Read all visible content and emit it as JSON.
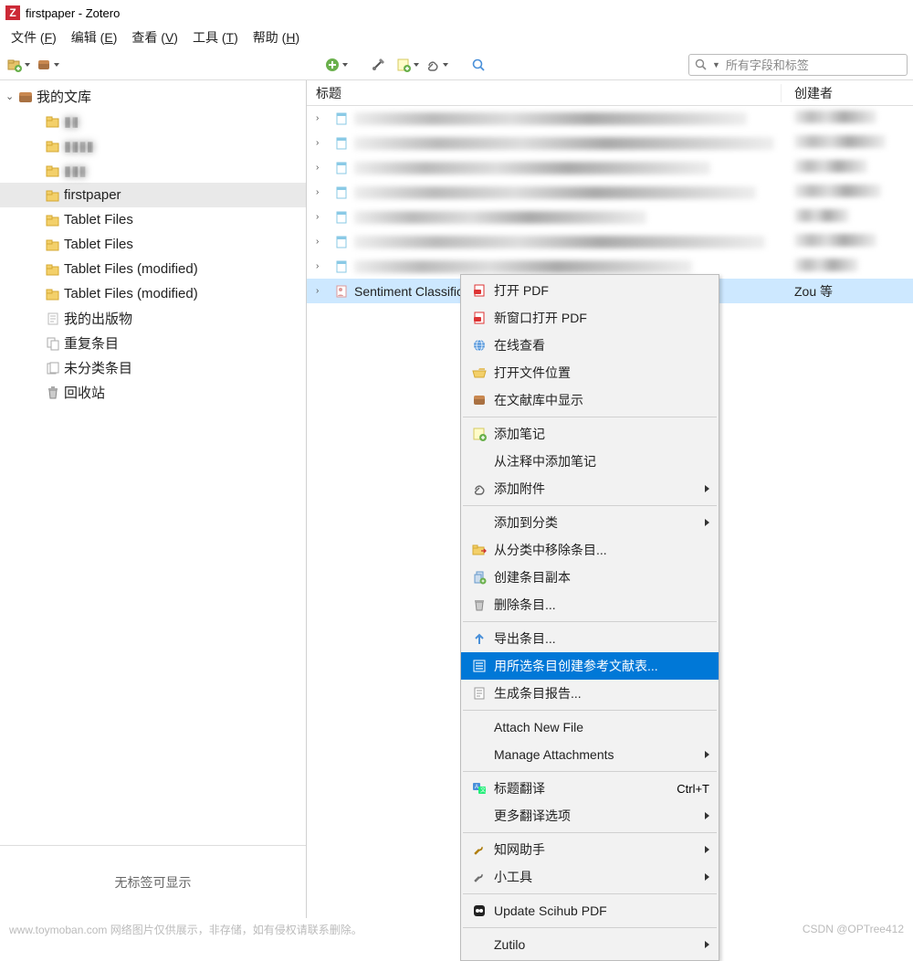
{
  "window": {
    "title": "firstpaper - Zotero"
  },
  "menubar": [
    {
      "label": "文件",
      "key": "F"
    },
    {
      "label": "编辑",
      "key": "E"
    },
    {
      "label": "查看",
      "key": "V"
    },
    {
      "label": "工具",
      "key": "T"
    },
    {
      "label": "帮助",
      "key": "H"
    }
  ],
  "search": {
    "placeholder": "所有字段和标签"
  },
  "sidebar": {
    "root": "我的文库",
    "items": [
      {
        "label": "▮▮",
        "icon": "folder",
        "blurred": true
      },
      {
        "label": "▮▮▮▮",
        "icon": "folder",
        "blurred": true
      },
      {
        "label": "▮▮▮",
        "icon": "folder",
        "blurred": true
      },
      {
        "label": "firstpaper",
        "icon": "folder",
        "selected": true
      },
      {
        "label": "Tablet Files",
        "icon": "folder"
      },
      {
        "label": "Tablet Files",
        "icon": "folder"
      },
      {
        "label": "Tablet Files (modified)",
        "icon": "folder"
      },
      {
        "label": "Tablet Files (modified)",
        "icon": "folder"
      },
      {
        "label": "我的出版物",
        "icon": "doc"
      },
      {
        "label": "重复条目",
        "icon": "dup"
      },
      {
        "label": "未分类条目",
        "icon": "unfiled"
      },
      {
        "label": "回收站",
        "icon": "trash"
      }
    ],
    "tag_empty": "无标签可显示"
  },
  "columns": {
    "title": "标题",
    "creator": "创建者"
  },
  "rows": [
    {
      "title_blur": 430,
      "creator_blur": 90
    },
    {
      "title_blur": 460,
      "creator_blur": 100
    },
    {
      "title_blur": 390,
      "creator_blur": 80
    },
    {
      "title_blur": 440,
      "creator_blur": 95
    },
    {
      "title_blur": 320,
      "creator_blur": 60
    },
    {
      "title_blur": 450,
      "creator_blur": 90
    },
    {
      "title_blur": 370,
      "creator_blur": 70
    }
  ],
  "selected_row": {
    "title": "Sentiment Classification Using Machine Learning Techni...",
    "creator": "Zou 等"
  },
  "context_menu": [
    {
      "type": "item",
      "label": "打开 PDF",
      "icon": "pdf"
    },
    {
      "type": "item",
      "label": "新窗口打开 PDF",
      "icon": "pdf"
    },
    {
      "type": "item",
      "label": "在线查看",
      "icon": "globe"
    },
    {
      "type": "item",
      "label": "打开文件位置",
      "icon": "folder-open"
    },
    {
      "type": "item",
      "label": "在文献库中显示",
      "icon": "box"
    },
    {
      "type": "sep"
    },
    {
      "type": "item",
      "label": "添加笔记",
      "icon": "note"
    },
    {
      "type": "item",
      "label": "从注释中添加笔记",
      "icon": ""
    },
    {
      "type": "item",
      "label": "添加附件",
      "icon": "clip",
      "submenu": true
    },
    {
      "type": "sep"
    },
    {
      "type": "item",
      "label": "添加到分类",
      "icon": "",
      "submenu": true
    },
    {
      "type": "item",
      "label": "从分类中移除条目...",
      "icon": "folder-out"
    },
    {
      "type": "item",
      "label": "创建条目副本",
      "icon": "dup"
    },
    {
      "type": "item",
      "label": "删除条目...",
      "icon": "trash"
    },
    {
      "type": "sep"
    },
    {
      "type": "item",
      "label": "导出条目...",
      "icon": "export"
    },
    {
      "type": "item",
      "label": "用所选条目创建参考文献表...",
      "icon": "list",
      "highlighted": true
    },
    {
      "type": "item",
      "label": "生成条目报告...",
      "icon": "report"
    },
    {
      "type": "sep"
    },
    {
      "type": "item",
      "label": "Attach New File",
      "icon": ""
    },
    {
      "type": "item",
      "label": "Manage Attachments",
      "icon": "",
      "submenu": true
    },
    {
      "type": "sep"
    },
    {
      "type": "item",
      "label": "标题翻译",
      "icon": "translate",
      "shortcut": "Ctrl+T"
    },
    {
      "type": "item",
      "label": "更多翻译选项",
      "icon": "",
      "submenu": true
    },
    {
      "type": "sep"
    },
    {
      "type": "item",
      "label": "知网助手",
      "icon": "wrench",
      "submenu": true
    },
    {
      "type": "item",
      "label": "小工具",
      "icon": "wrench2",
      "submenu": true
    },
    {
      "type": "sep"
    },
    {
      "type": "item",
      "label": "Update Scihub PDF",
      "icon": "scihub"
    },
    {
      "type": "sep"
    },
    {
      "type": "item",
      "label": "Zutilo",
      "icon": "",
      "submenu": true
    }
  ],
  "footer": {
    "left": "www.toymoban.com 网络图片仅供展示，非存储，如有侵权请联系删除。",
    "right": "CSDN @OPTree412"
  }
}
